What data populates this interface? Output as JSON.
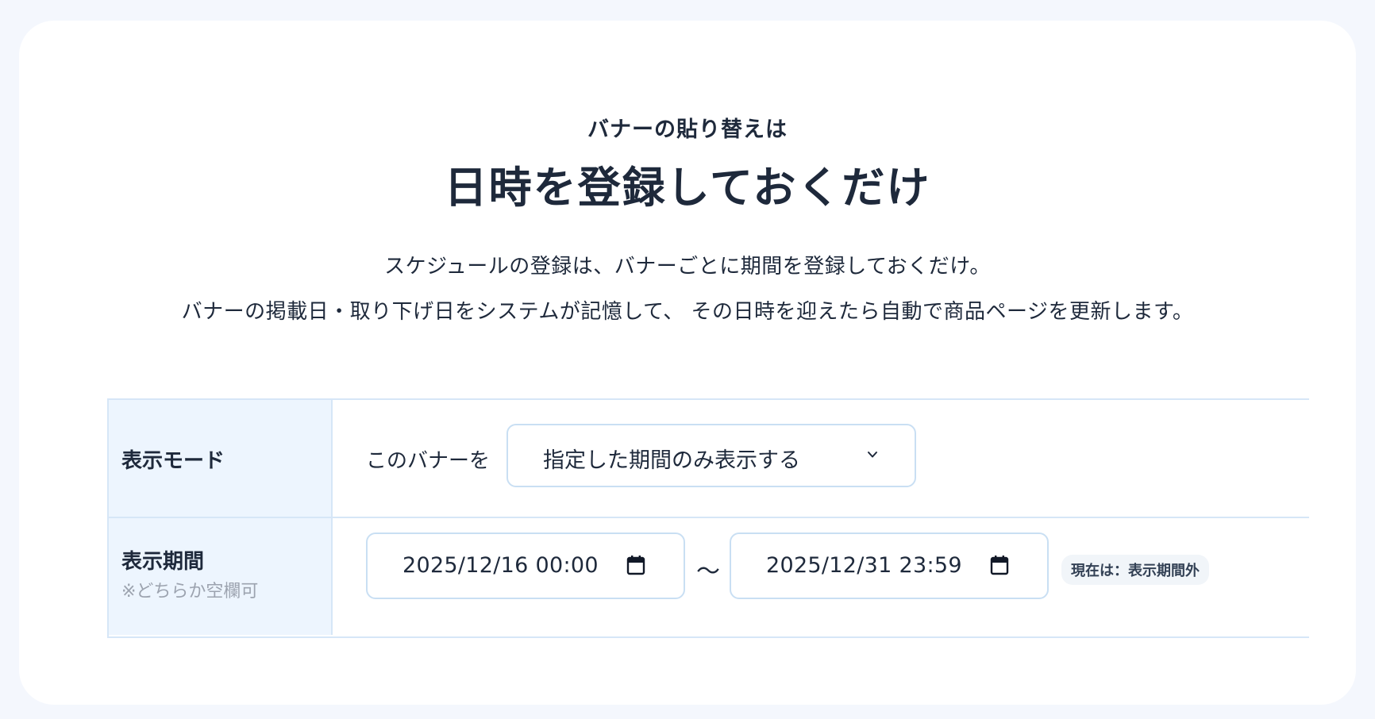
{
  "hero": {
    "kicker": "バナーの貼り替えは",
    "headline": "日時を登録しておくだけ",
    "description_line1": "スケジュールの登録は、バナーごとに期間を登録しておくだけ。",
    "description_line2": "バナーの掲載日・取り下げ日をシステムが記憶して、 その日時を迎えたら自動で商品ページを更新します。"
  },
  "settings": {
    "mode": {
      "label": "表示モード",
      "prefix": "このバナーを",
      "selected": "指定した期間のみ表示する"
    },
    "period": {
      "label": "表示期間",
      "note": "※どちらか空欄可",
      "start": "2025/12/16 00:00",
      "separator": "〜",
      "end": "2025/12/31 23:59",
      "status": "現在は：表示期間外"
    }
  },
  "icons": {
    "select": "chevron-down-icon",
    "date": "calendar-icon"
  },
  "colors": {
    "page_background": "#f4f7fd",
    "card_background": "#ffffff",
    "label_cell_background": "#edf5fe",
    "border": "#d6e6f7",
    "text": "#1e293b",
    "muted_text": "#9ca3af"
  }
}
